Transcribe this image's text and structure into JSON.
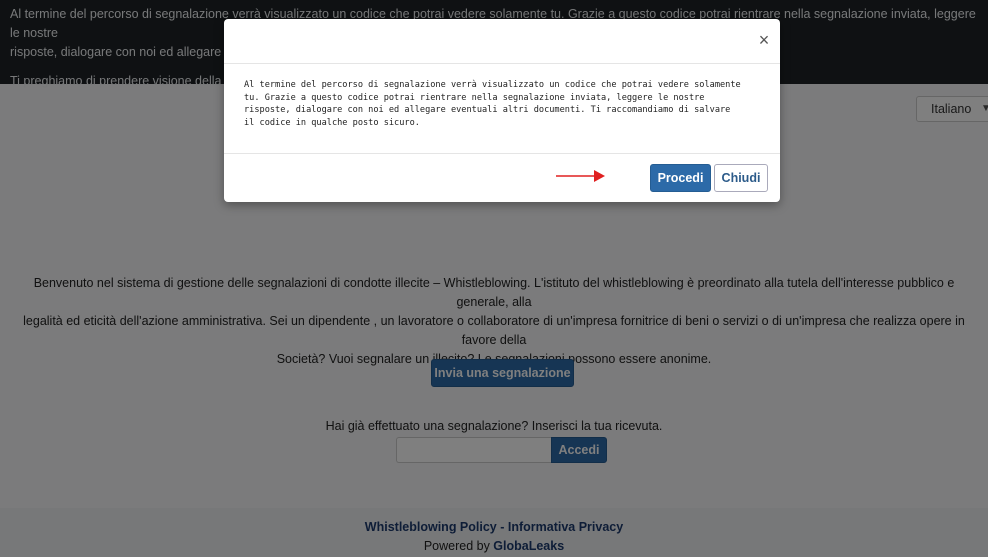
{
  "banner": {
    "line1": "Al termine del percorso di segnalazione verrà visualizzato un codice che potrai vedere solamente tu. Grazie a questo codice potrai rientrare nella segnalazione inviata, leggere le nostre",
    "line2": "risposte, dialogare con noi ed allegare eventuali altri documenti.",
    "line3": "Ti preghiamo di prendere visione della Policy."
  },
  "language": {
    "selected": "Italiano"
  },
  "main": {
    "welcome_line1": "Benvenuto nel sistema di gestione delle segnalazioni di condotte illecite – Whistleblowing. L'istituto del whistleblowing è preordinato alla tutela dell'interesse pubblico e generale, alla",
    "welcome_line2": "legalità ed eticità dell'azione amministrativa. Sei un dipendente , un lavoratore o collaboratore di un'impresa fornitrice di beni o servizi o di un'impresa che realizza opere in favore della",
    "welcome_line3": "Società? Vuoi segnalare un illecito? Le segnalazioni possono essere anonime.",
    "submit_button": "Invia una segnalazione",
    "receipt_prompt": "Hai già effettuato una segnalazione? Inserisci la tua ricevuta.",
    "receipt_placeholder": "",
    "login_button": "Accedi"
  },
  "footer": {
    "policy_link": "Whistleblowing Policy",
    "separator": " - ",
    "privacy_link": "Informativa Privacy",
    "powered_prefix": "Powered by ",
    "powered_brand": "GlobaLeaks"
  },
  "modal": {
    "close_symbol": "×",
    "body_line1": "Al termine del percorso di segnalazione verrà visualizzato un codice che potrai vedere solamente",
    "body_line2": "tu. Grazie a questo codice potrai rientrare nella segnalazione inviata, leggere le nostre",
    "body_line3": "risposte, dialogare con noi ed allegare eventuali altri documenti. Ti raccomandiamo di salvare",
    "body_line4": "il codice in qualche posto sicuro.",
    "proceed_button": "Procedi",
    "close_button": "Chiudi"
  },
  "colors": {
    "primary": "#2c6aa8",
    "banner_bg": "#1e2327",
    "arrow": "#e02020"
  }
}
